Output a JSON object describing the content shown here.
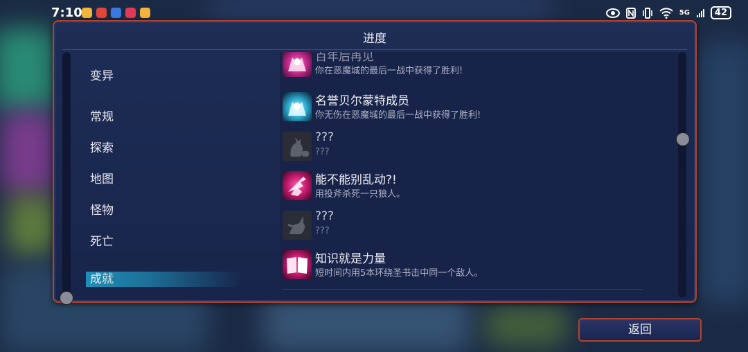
{
  "status_bar": {
    "time": "7:10",
    "network": "5G",
    "battery": "42",
    "icons": [
      "eye-icon",
      "nfc-icon",
      "vibrate-icon",
      "wifi-icon",
      "signal-icon"
    ]
  },
  "panel": {
    "title": "进度"
  },
  "categories": [
    {
      "label": "变异",
      "active": false
    },
    {
      "label": "常规",
      "active": false
    },
    {
      "label": "探索",
      "active": false
    },
    {
      "label": "地图",
      "active": false
    },
    {
      "label": "怪物",
      "active": false
    },
    {
      "label": "死亡",
      "active": false
    },
    {
      "label": "成就",
      "active": true
    }
  ],
  "achievements": [
    {
      "name": "百年后再见",
      "desc": "你在恶魔城的最后一战中获得了胜利!",
      "icon": "demon-castle-icon",
      "color": "#d23aa0",
      "locked": false
    },
    {
      "name": "名誉贝尔蒙特成员",
      "desc": "你无伤在恶魔城的最后一战中获得了胜利!",
      "icon": "demon-castle-icon",
      "color": "#2fb3d4",
      "locked": false
    },
    {
      "name": "???",
      "desc": "???",
      "icon": "cat-silhouette-icon",
      "color": "#555a66",
      "locked": true
    },
    {
      "name": "能不能别乱动?!",
      "desc": "用投斧杀死一只狼人。",
      "icon": "axe-wolf-icon",
      "color": "#d6207a",
      "locked": false
    },
    {
      "name": "???",
      "desc": "???",
      "icon": "creature-silhouette-icon",
      "color": "#555a66",
      "locked": true
    },
    {
      "name": "知识就是力量",
      "desc": "短时间内用5本环绕圣书击中同一个敌人。",
      "icon": "book-icon",
      "color": "#d6207a",
      "locked": false
    }
  ],
  "buttons": {
    "back": "返回"
  }
}
